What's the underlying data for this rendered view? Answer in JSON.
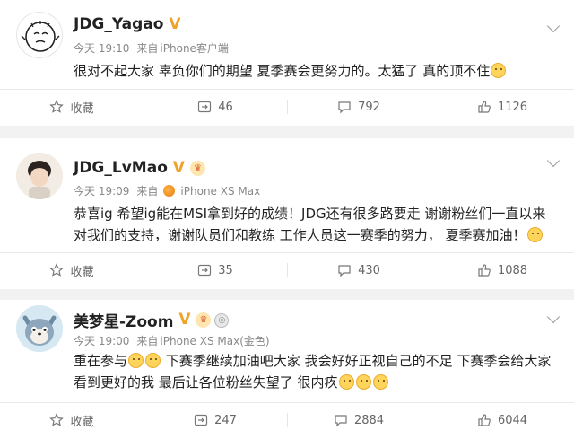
{
  "posts": [
    {
      "username": "JDG_Yagao",
      "time": "今天 19:10",
      "source_prefix": "来自",
      "source": "iPhone客户端",
      "text": "很对不起大家 辜负你们的期望 夏季赛会更努力的。太猛了 真的顶不住",
      "favorite_label": "收藏",
      "reposts": "46",
      "comments": "792",
      "likes": "1126"
    },
    {
      "username": "JDG_LvMao",
      "time": "今天 19:09",
      "source_prefix": "来自",
      "source": "iPhone XS Max",
      "text_line1": "恭喜ig 希望ig能在MSI拿到好的成绩！JDG还有很多路要走 谢谢粉丝们一直以来",
      "text_line2": "对我们的支持，谢谢队员们和教练 工作人员这一赛季的努力， 夏季赛加油！",
      "favorite_label": "收藏",
      "reposts": "35",
      "comments": "430",
      "likes": "1088"
    },
    {
      "username": "美梦星-Zoom",
      "time": "今天 19:00",
      "source_prefix": "来自",
      "source": "iPhone XS Max(金色)",
      "text_part1": "重在参与",
      "text_part2": "下赛季继续加油吧大家 我会好好正视自己的不足 下赛季会给大家",
      "text_line2": "看到更好的我 最后让各位粉丝失望了 很内疚",
      "favorite_label": "收藏",
      "reposts": "247",
      "comments": "2884",
      "likes": "6044"
    }
  ],
  "icons": {
    "verified": "verified-v-icon",
    "crown": "crown-badge-icon",
    "medal": "medal-badge-icon",
    "star": "star-icon",
    "repost": "repost-icon",
    "comment": "comment-icon",
    "like": "thumbs-up-icon",
    "more": "chevron-down-icon",
    "source": "orange-fruit-icon"
  },
  "colors": {
    "verified": "#f0a22a",
    "text": "#222222",
    "meta": "#888888",
    "background": "#f2f2f2"
  }
}
